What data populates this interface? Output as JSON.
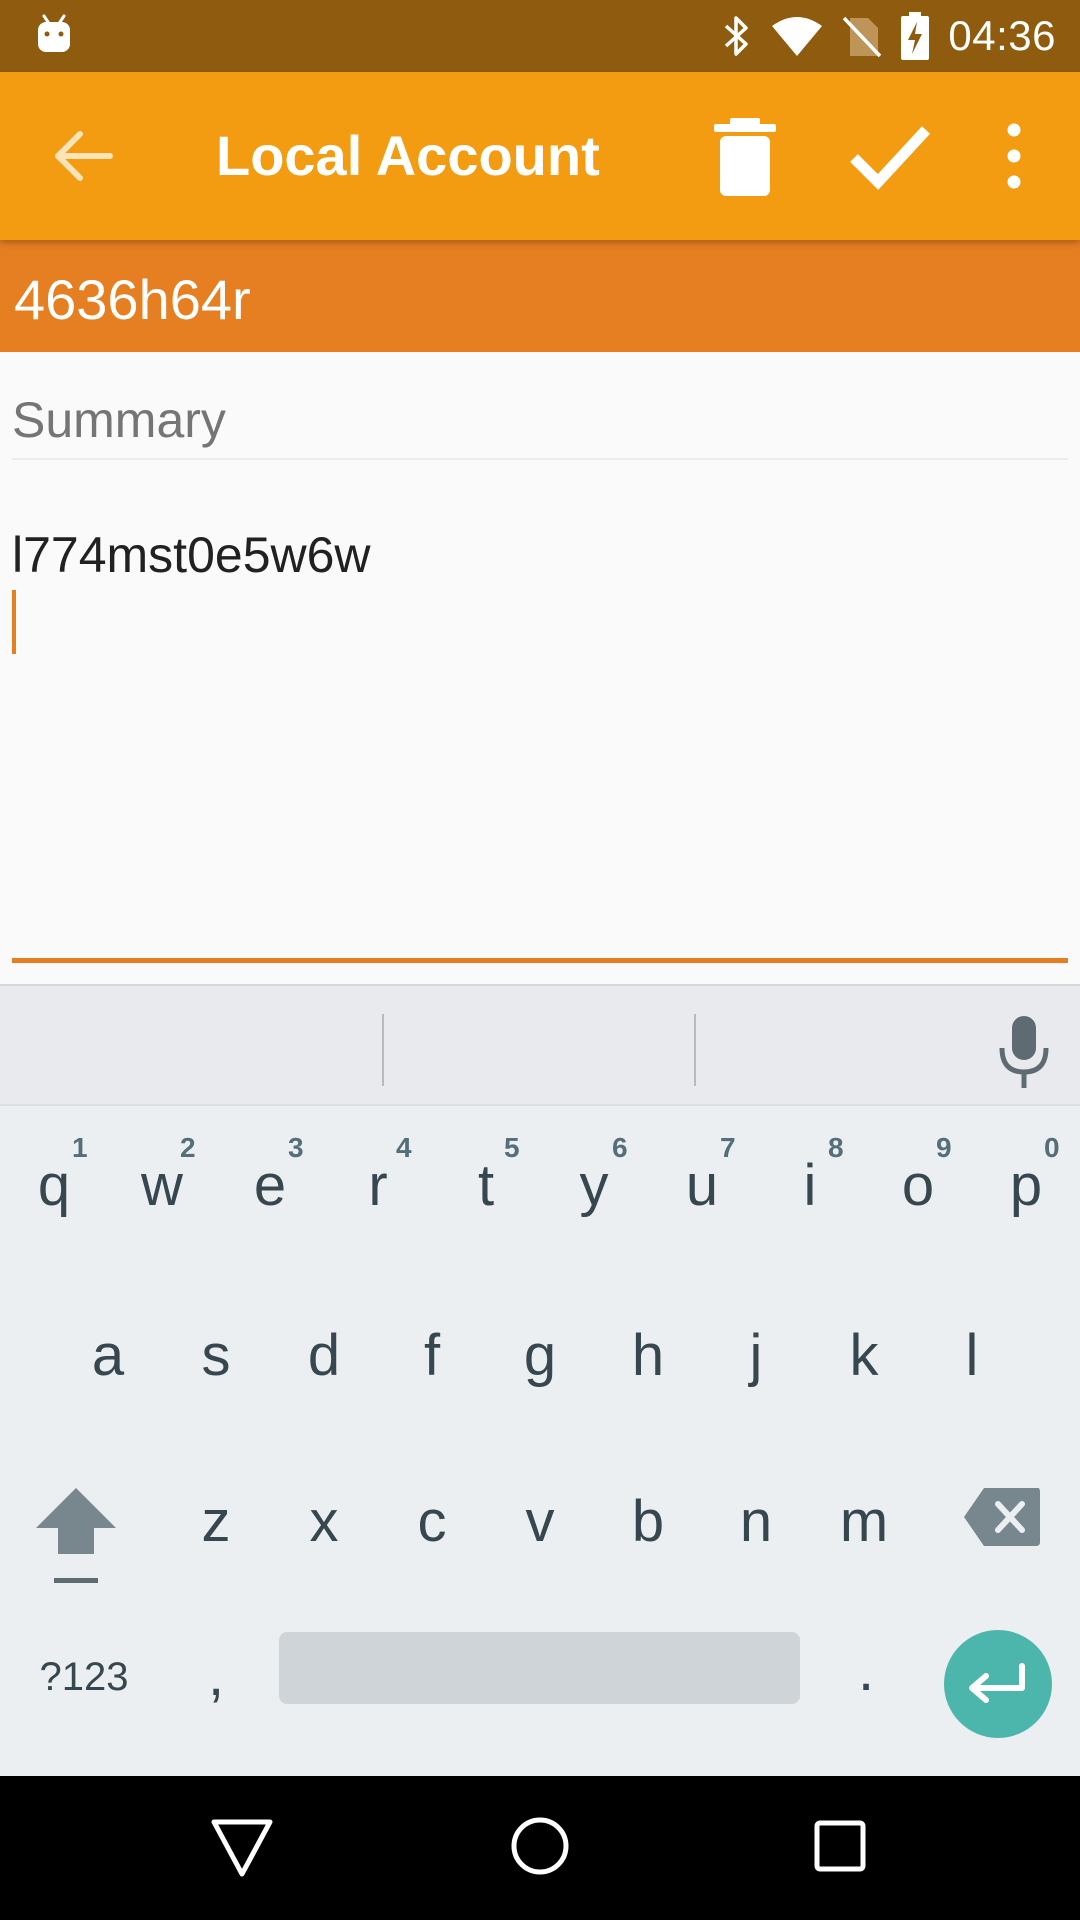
{
  "status_bar": {
    "time": "04:36",
    "background": "#8f5c0f",
    "icons": [
      "android-icon",
      "bluetooth-icon",
      "wifi-icon",
      "no-sim-icon",
      "battery-charging-icon"
    ]
  },
  "toolbar": {
    "title": "Local Account",
    "background": "#f39c12",
    "icons": [
      "back-arrow-icon",
      "delete-icon",
      "check-icon",
      "more-vert-icon"
    ]
  },
  "account": {
    "name": "4636h64r",
    "background": "#e67e22"
  },
  "summary": {
    "label": "Summary",
    "value": "l774mst0e5w6w",
    "accent": "#e67e22"
  },
  "keyboard": {
    "row1": [
      {
        "key": "q",
        "hint": "1"
      },
      {
        "key": "w",
        "hint": "2"
      },
      {
        "key": "e",
        "hint": "3"
      },
      {
        "key": "r",
        "hint": "4"
      },
      {
        "key": "t",
        "hint": "5"
      },
      {
        "key": "y",
        "hint": "6"
      },
      {
        "key": "u",
        "hint": "7"
      },
      {
        "key": "i",
        "hint": "8"
      },
      {
        "key": "o",
        "hint": "9"
      },
      {
        "key": "p",
        "hint": "0"
      }
    ],
    "row2": [
      "a",
      "s",
      "d",
      "f",
      "g",
      "h",
      "j",
      "k",
      "l"
    ],
    "row3": [
      "z",
      "x",
      "c",
      "v",
      "b",
      "n",
      "m"
    ],
    "symbols_label": "?123",
    "comma": ",",
    "period": ".",
    "enter_color": "#4db6ac",
    "icons": [
      "microphone-icon",
      "shift-icon",
      "backspace-icon",
      "enter-icon"
    ]
  },
  "nav_bar": {
    "icons": [
      "nav-back-icon",
      "nav-home-icon",
      "nav-recents-icon"
    ]
  }
}
